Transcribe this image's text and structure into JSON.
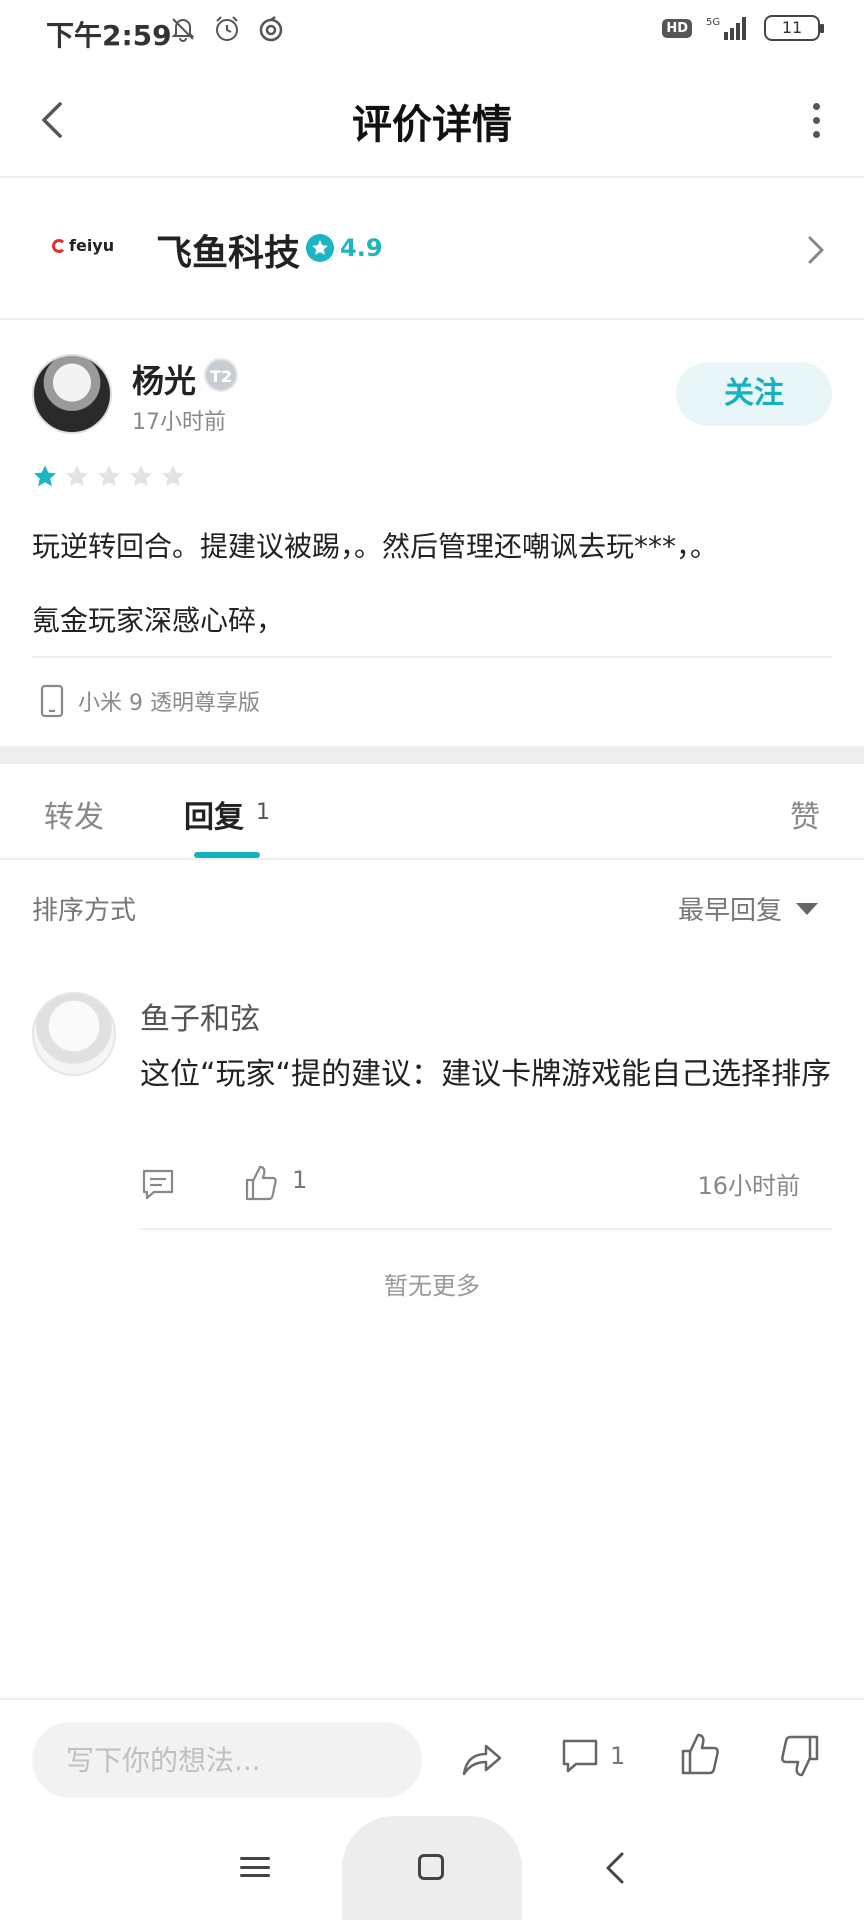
{
  "status_bar": {
    "time": "下午2:59",
    "hd": "HD",
    "network": "5G",
    "battery": "11"
  },
  "header": {
    "title": "评价详情"
  },
  "developer": {
    "logo_text": "feiyu",
    "name": "飞鱼科技",
    "rating": "4.9"
  },
  "review": {
    "username": "杨光",
    "level_badge": "T2",
    "time": "17小时前",
    "follow_label": "关注",
    "stars_filled": 1,
    "stars_total": 5,
    "text_line1": "玩逆转回合。提建议被踢，。然后管理还嘲讽去玩***，。",
    "text_line2": "氪金玩家深感心碎，",
    "device": "小米 9 透明尊享版"
  },
  "tabs": {
    "forward": "转发",
    "reply": "回复",
    "reply_count": "1",
    "like": "赞"
  },
  "sort": {
    "label": "排序方式",
    "selected": "最早回复"
  },
  "reply": {
    "username": "鱼子和弦",
    "text": "这位“玩家“提的建议：建议卡牌游戏能自己选择排序",
    "like_count": "1",
    "time": "16小时前"
  },
  "no_more": "暂无更多",
  "bottom_bar": {
    "input_placeholder": "写下你的想法...",
    "comment_count": "1"
  },
  "colors": {
    "accent": "#16b1c0",
    "star_filled": "#1bb5c4",
    "star_empty": "#e2e2e2"
  }
}
